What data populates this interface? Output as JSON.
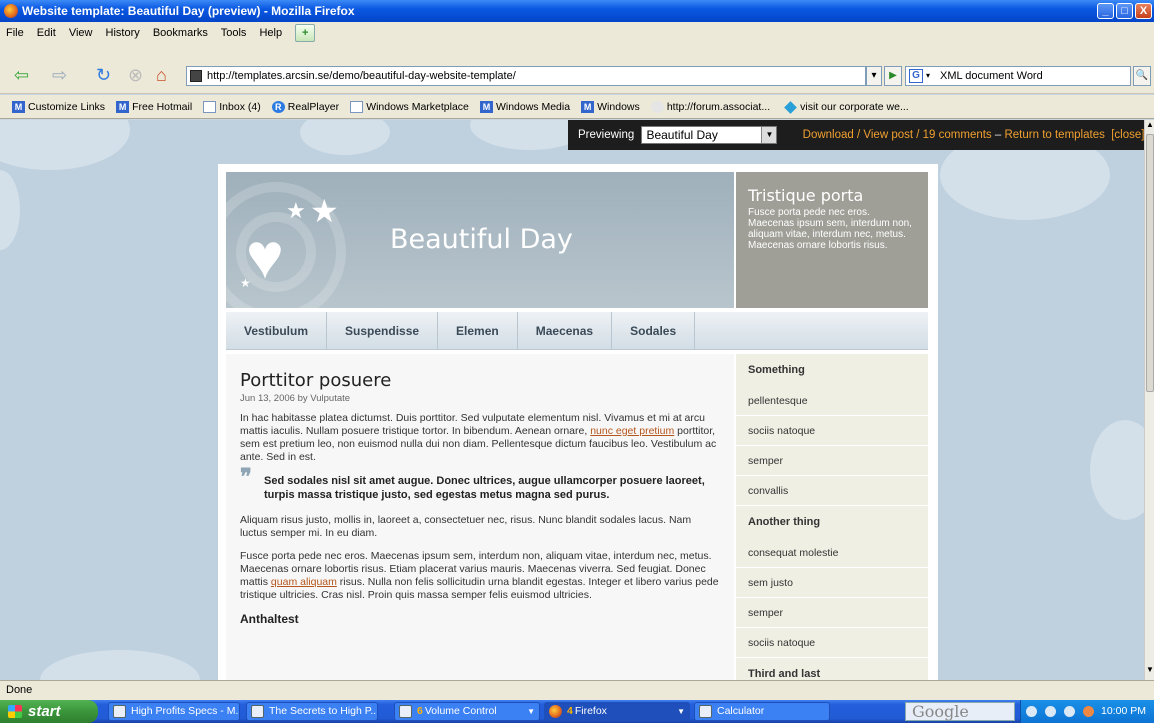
{
  "window": {
    "title": "Website template: Beautiful Day (preview) - Mozilla Firefox",
    "controls": {
      "minimize": "_",
      "maximize": "□",
      "close": "X"
    }
  },
  "menu": [
    "File",
    "Edit",
    "View",
    "History",
    "Bookmarks",
    "Tools",
    "Help"
  ],
  "toolbar": {
    "back": "⇦",
    "forward": "⇨",
    "reload": "↻",
    "stop": "⊗",
    "home": "⌂",
    "url": "http://templates.arcsin.se/demo/beautiful-day-website-template/",
    "go": "▶",
    "dropdown": "▾",
    "search_engine": "G",
    "search_value": "XML document Word",
    "search_icon": "🔍"
  },
  "bookmarks": [
    {
      "label": "Customize Links",
      "icon": "msn-icon",
      "glyph": "M"
    },
    {
      "label": "Free Hotmail",
      "icon": "msn-icon",
      "glyph": "M"
    },
    {
      "label": "Inbox (4)",
      "icon": "page-icon",
      "glyph": ""
    },
    {
      "label": "RealPlayer",
      "icon": "realplayer-icon",
      "glyph": "R"
    },
    {
      "label": "Windows Marketplace",
      "icon": "page-icon",
      "glyph": ""
    },
    {
      "label": "Windows Media",
      "icon": "msn-icon",
      "glyph": "M"
    },
    {
      "label": "Windows",
      "icon": "msn-icon",
      "glyph": "M"
    },
    {
      "label": "http://forum.associat...",
      "icon": "faded-icon",
      "glyph": ""
    },
    {
      "label": "visit our corporate we...",
      "icon": "diamond-icon",
      "glyph": ""
    }
  ],
  "preview": {
    "label": "Previewing",
    "selected": "Beautiful Day",
    "select_arrow": "▼",
    "download": "Download",
    "sep1": " / ",
    "view_post": "View post",
    "sep2": " / ",
    "comments": "19 comments",
    "dash": " – ",
    "return": "Return to templates",
    "close": "[close]"
  },
  "page": {
    "site_title": "Beautiful Day",
    "heart_glyph": "♥",
    "star_glyph": "★",
    "aside": {
      "title": "Tristique porta",
      "text": "Fusce porta pede nec eros. Maecenas ipsum sem, interdum non, aliquam vitae, interdum nec, metus. Maecenas ornare lobortis risus."
    },
    "nav": [
      "Vestibulum",
      "Suspendisse",
      "Elemen",
      "Maecenas",
      "Sodales"
    ],
    "post": {
      "title": "Porttitor posuere",
      "meta": "Jun 13, 2006 by Vulputate",
      "p1_a": "In hac habitasse platea dictumst. Duis porttitor. Sed vulputate elementum nisl. Vivamus et mi at arcu mattis iaculis. Nullam posuere tristique tortor. In bibendum. Aenean ornare, ",
      "p1_link": "nunc eget pretium",
      "p1_b": " porttitor, sem est pretium leo, non euismod nulla dui non diam. Pellentesque dictum faucibus leo. Vestibulum ac ante. Sed in est.",
      "quote_mark": "❞",
      "quote": "Sed sodales nisl sit amet augue. Donec ultrices, augue ullamcorper posuere laoreet, turpis massa tristique justo, sed egestas metus magna sed purus.",
      "p2": "Aliquam risus justo, mollis in, laoreet a, consectetuer nec, risus. Nunc blandit sodales lacus. Nam luctus semper mi. In eu diam.",
      "p3_a": "Fusce porta pede nec eros. Maecenas ipsum sem, interdum non, aliquam vitae, interdum nec, metus. Maecenas ornare lobortis risus. Etiam placerat varius mauris. Maecenas viverra. Sed feugiat. Donec mattis ",
      "p3_link": "quam aliquam",
      "p3_b": " risus. Nulla non felis sollicitudin urna blandit egestas. Integer et libero varius pede tristique ultricies. Cras nisl. Proin quis massa semper felis euismod ultricies.",
      "next_heading": "Anthaltest"
    },
    "sidebar": [
      {
        "heading": "Something",
        "items": [
          "pellentesque",
          "sociis natoque",
          "semper",
          "convallis"
        ]
      },
      {
        "heading": "Another thing",
        "items": [
          "consequat molestie",
          "sem justo",
          "semper",
          "sociis natoque"
        ]
      },
      {
        "heading": "Third and last",
        "items": []
      }
    ]
  },
  "status": "Done",
  "taskbar": {
    "start": "start",
    "tasks": [
      {
        "label": "High Profits Specs - M...",
        "num": ""
      },
      {
        "label": "The Secrets to High P...",
        "num": ""
      },
      {
        "label": "Volume Control",
        "num": "6"
      },
      {
        "label": "Firefox",
        "num": "4"
      },
      {
        "label": "Calculator",
        "num": ""
      }
    ],
    "google": "Google",
    "clock": "10:00 PM"
  }
}
